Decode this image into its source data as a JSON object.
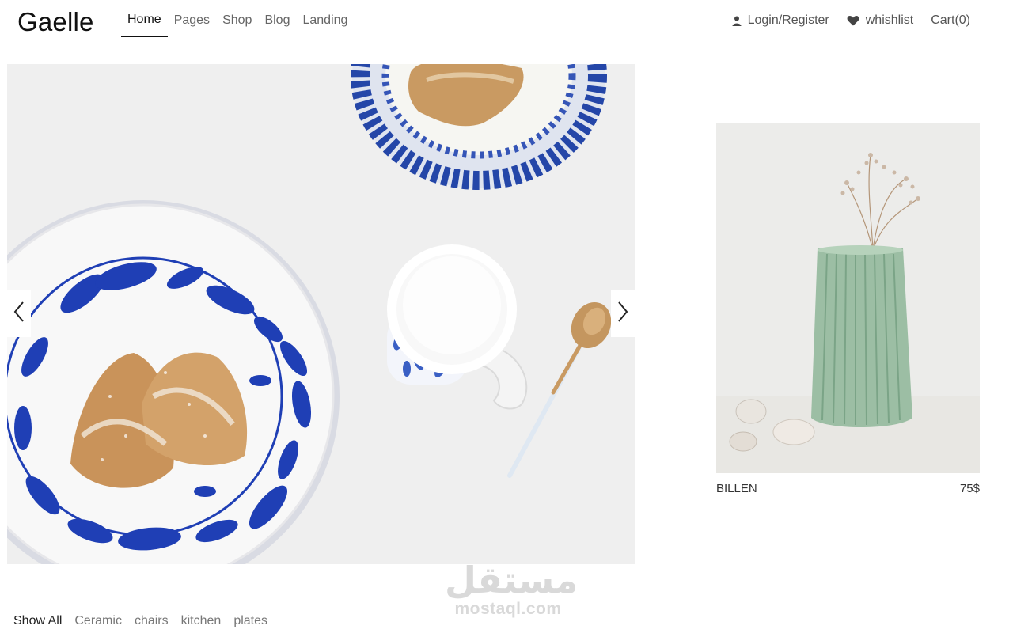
{
  "brand": {
    "logo": "Gaelle"
  },
  "nav": {
    "items": [
      {
        "label": "Home",
        "active": true
      },
      {
        "label": "Pages"
      },
      {
        "label": "Shop"
      },
      {
        "label": "Blog"
      },
      {
        "label": "Landing"
      }
    ]
  },
  "account": {
    "login": "Login/Register",
    "login_icon": "user-icon",
    "wishlist": "whishlist",
    "wishlist_icon": "heart-icon",
    "cart": "Cart(0)"
  },
  "hero": {
    "prev_icon": "chevron-left-icon",
    "next_icon": "chevron-right-icon"
  },
  "product": {
    "name": "BILLEN",
    "price": "75$"
  },
  "watermark": {
    "arabic": "مستقل",
    "latin": "mostaql.com"
  },
  "filters": [
    {
      "label": "Show All",
      "active": true
    },
    {
      "label": "Ceramic"
    },
    {
      "label": "chairs"
    },
    {
      "label": "kitchen"
    },
    {
      "label": "plates"
    }
  ],
  "colors": {
    "accent": "#111111",
    "plate_blue": "#1f3fb5",
    "vase_green": "#8fb89a"
  }
}
